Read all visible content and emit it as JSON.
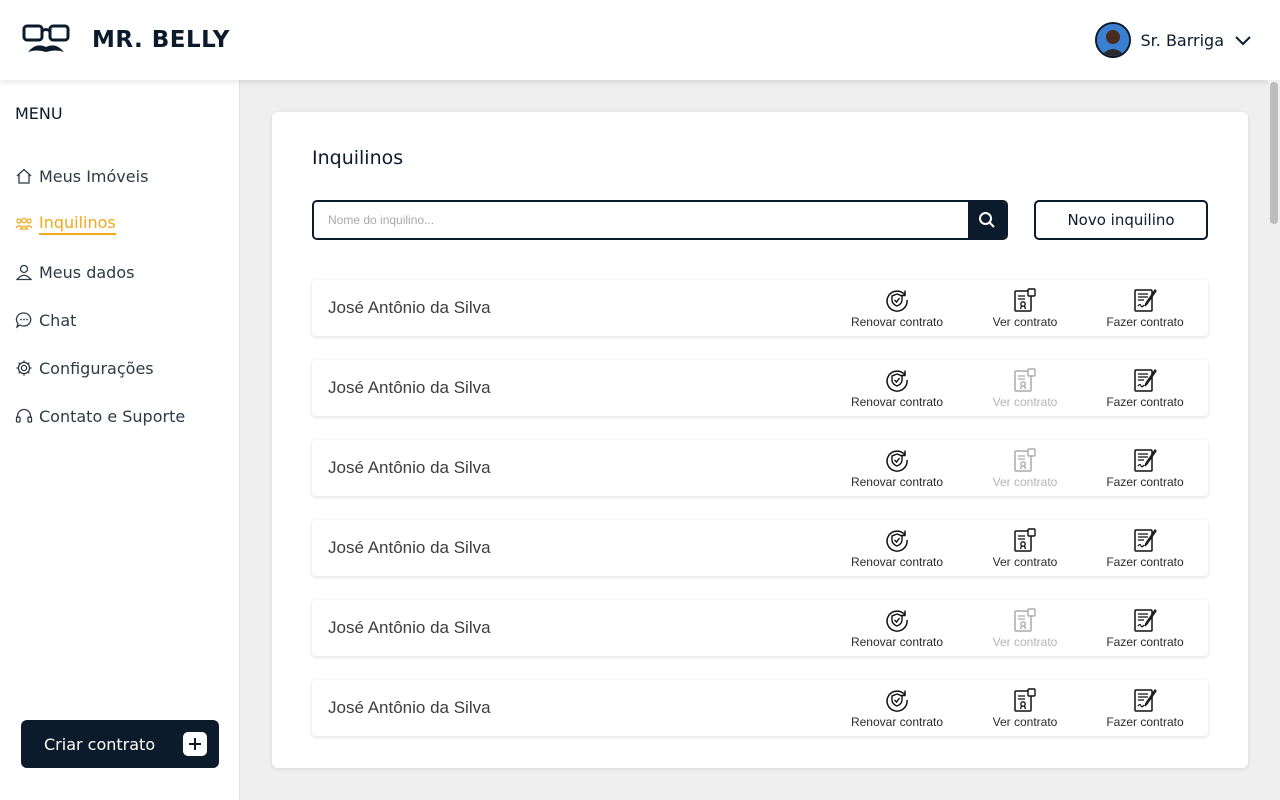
{
  "header": {
    "brand": "MR. BELLY",
    "user_name": "Sr. Barriga"
  },
  "sidebar": {
    "menu_title": "MENU",
    "items": [
      {
        "label": "Meus Imóveis",
        "icon": "home-icon",
        "active": false
      },
      {
        "label": "Inquilinos",
        "icon": "users-icon",
        "active": true
      },
      {
        "label": "Meus dados",
        "icon": "user-icon",
        "active": false
      },
      {
        "label": "Chat",
        "icon": "chat-icon",
        "active": false
      },
      {
        "label": "Configurações",
        "icon": "gear-icon",
        "active": false
      },
      {
        "label": "Contato e Suporte",
        "icon": "headset-icon",
        "active": false
      }
    ],
    "cta_label": "Criar contrato"
  },
  "main": {
    "title": "Inquilinos",
    "search_placeholder": "Nome do inquilino...",
    "new_button": "Novo inquilino",
    "action_labels": {
      "renew": "Renovar contrato",
      "view": "Ver contrato",
      "make": "Fazer contrato"
    },
    "tenants": [
      {
        "name": "José Antônio da Silva",
        "view_enabled": true
      },
      {
        "name": "José Antônio da Silva",
        "view_enabled": false
      },
      {
        "name": "José Antônio da Silva",
        "view_enabled": false
      },
      {
        "name": "José Antônio da Silva",
        "view_enabled": true
      },
      {
        "name": "José Antônio da Silva",
        "view_enabled": false
      },
      {
        "name": "José Antônio da Silva",
        "view_enabled": true
      }
    ]
  },
  "colors": {
    "primary": "#0b1b2b",
    "accent": "#f2a81d",
    "background": "#efefef"
  }
}
